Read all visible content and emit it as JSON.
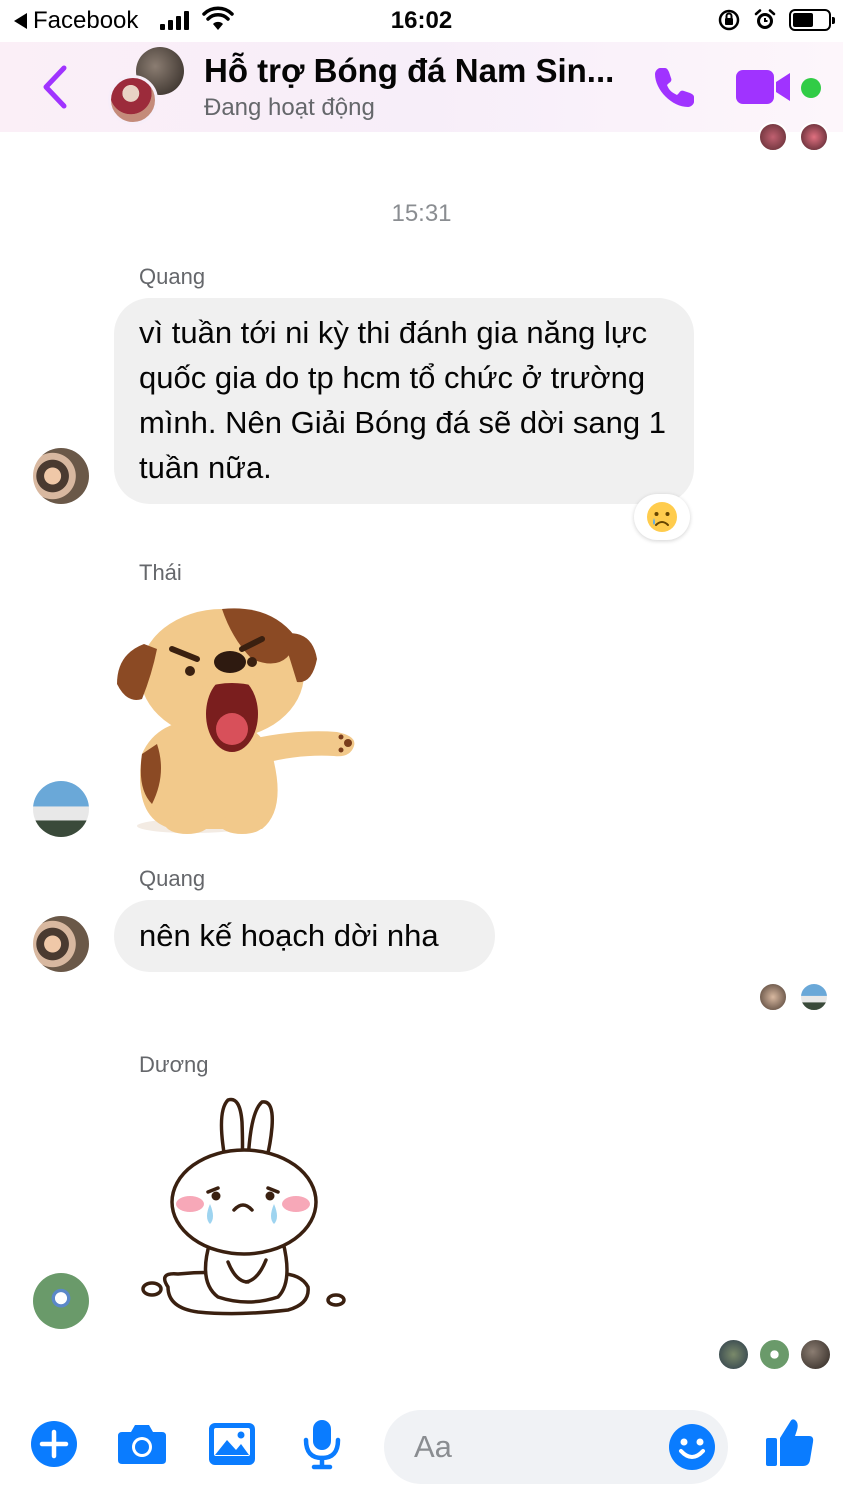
{
  "status_bar": {
    "back_app": "Facebook",
    "time": "16:02"
  },
  "header": {
    "title": "Hỗ trợ Bóng đá Nam Sin...",
    "subtitle": "Đang hoạt động"
  },
  "conversation": {
    "time_separator": "15:31",
    "messages": [
      {
        "sender": "Quang",
        "text": "vì tuần tới ni kỳ thi đánh gia năng lực quốc gia do tp hcm tổ chức ở trường mình. Nên Giải Bóng đá sẽ dời sang 1 tuần nữa.",
        "reaction": "crying-face"
      },
      {
        "sender": "Thái",
        "sticker": "puppy-pointing-sticker"
      },
      {
        "sender": "Quang",
        "text": "nên kế hoạch dời nha"
      },
      {
        "sender": "Dương",
        "sticker": "crying-bunny-sticker"
      }
    ]
  },
  "composer": {
    "placeholder": "Aa"
  },
  "colors": {
    "accent": "#a033ff",
    "messenger_blue": "#0a7cff",
    "bubble_gray": "#f0f0f0",
    "online_green": "#31cc46"
  }
}
